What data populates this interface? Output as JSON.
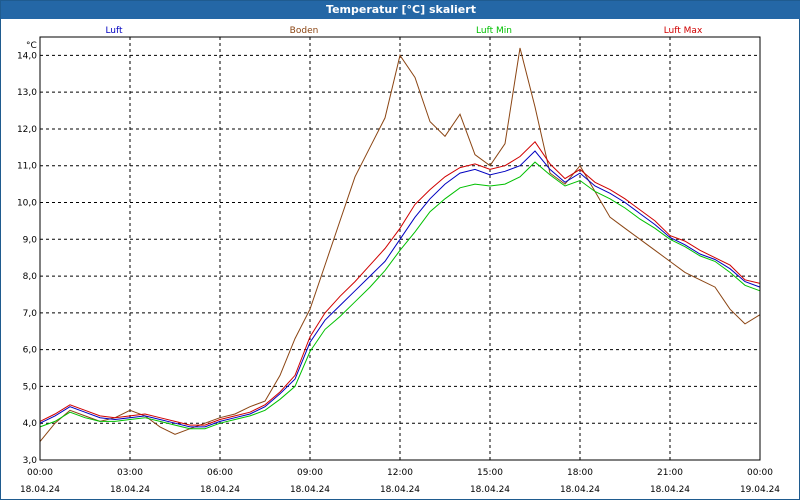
{
  "window": {
    "title": "Temperatur [°C] skaliert"
  },
  "chart_data": {
    "type": "line",
    "title": "Temperatur [°C] skaliert",
    "ylabel": "°C",
    "xlabel": "",
    "ylim": [
      3.0,
      14.5
    ],
    "xlim": [
      0,
      24
    ],
    "grid": true,
    "legend_position": "top",
    "yticks": [
      "3,0",
      "4,0",
      "5,0",
      "6,0",
      "7,0",
      "8,0",
      "9,0",
      "10,0",
      "11,0",
      "12,0",
      "13,0",
      "14,0"
    ],
    "xticks": [
      {
        "time": "00:00",
        "date": "18.04.24"
      },
      {
        "time": "03:00",
        "date": "18.04.24"
      },
      {
        "time": "06:00",
        "date": "18.04.24"
      },
      {
        "time": "09:00",
        "date": "18.04.24"
      },
      {
        "time": "12:00",
        "date": "18.04.24"
      },
      {
        "time": "15:00",
        "date": "18.04.24"
      },
      {
        "time": "18:00",
        "date": "18.04.24"
      },
      {
        "time": "21:00",
        "date": "18.04.24"
      },
      {
        "time": "00:00",
        "date": "19.04.24"
      }
    ],
    "x": [
      0,
      0.5,
      1,
      1.5,
      2,
      2.5,
      3,
      3.5,
      4,
      4.5,
      5,
      5.5,
      6,
      6.5,
      7,
      7.5,
      8,
      8.5,
      9,
      9.5,
      10,
      10.5,
      11,
      11.5,
      12,
      12.5,
      13,
      13.5,
      14,
      14.5,
      15,
      15.5,
      16,
      16.5,
      17,
      17.5,
      18,
      18.5,
      19,
      19.5,
      20,
      20.5,
      21,
      21.5,
      22,
      22.5,
      23,
      23.5,
      24
    ],
    "series": [
      {
        "name": "Luft",
        "color": "#0000c0",
        "values": [
          4.0,
          4.2,
          4.45,
          4.3,
          4.15,
          4.1,
          4.15,
          4.2,
          4.1,
          4.0,
          3.9,
          3.9,
          4.05,
          4.15,
          4.25,
          4.45,
          4.8,
          5.2,
          6.2,
          6.8,
          7.2,
          7.6,
          8.0,
          8.4,
          9.0,
          9.6,
          10.1,
          10.5,
          10.8,
          10.9,
          10.75,
          10.85,
          11.0,
          11.4,
          10.9,
          10.55,
          10.8,
          10.45,
          10.25,
          10.0,
          9.7,
          9.4,
          9.05,
          8.85,
          8.6,
          8.45,
          8.2,
          7.85,
          7.7
        ]
      },
      {
        "name": "Boden",
        "color": "#8b4513",
        "values": [
          3.5,
          4.0,
          4.35,
          4.2,
          4.05,
          4.15,
          4.35,
          4.2,
          3.9,
          3.7,
          3.85,
          4.0,
          4.15,
          4.25,
          4.45,
          4.6,
          5.3,
          6.3,
          7.1,
          8.3,
          9.5,
          10.7,
          11.5,
          12.3,
          14.0,
          13.4,
          12.2,
          11.8,
          12.4,
          11.3,
          11.0,
          11.6,
          14.2,
          12.6,
          10.8,
          10.5,
          11.0,
          10.3,
          9.6,
          9.3,
          9.0,
          8.7,
          8.4,
          8.1,
          7.9,
          7.7,
          7.1,
          6.7,
          6.95
        ]
      },
      {
        "name": "Luft Min",
        "color": "#00c000",
        "values": [
          3.9,
          4.05,
          4.3,
          4.15,
          4.05,
          4.05,
          4.1,
          4.15,
          4.05,
          3.95,
          3.85,
          3.85,
          4.0,
          4.1,
          4.2,
          4.35,
          4.65,
          5.0,
          5.95,
          6.55,
          6.9,
          7.3,
          7.7,
          8.15,
          8.7,
          9.2,
          9.75,
          10.1,
          10.4,
          10.5,
          10.45,
          10.5,
          10.7,
          11.1,
          10.75,
          10.45,
          10.6,
          10.3,
          10.1,
          9.85,
          9.55,
          9.3,
          9.0,
          8.8,
          8.55,
          8.4,
          8.1,
          7.75,
          7.6
        ]
      },
      {
        "name": "Luft Max",
        "color": "#d00000",
        "values": [
          4.05,
          4.25,
          4.5,
          4.35,
          4.2,
          4.15,
          4.2,
          4.25,
          4.15,
          4.05,
          3.95,
          3.95,
          4.1,
          4.2,
          4.3,
          4.5,
          4.85,
          5.3,
          6.35,
          7.0,
          7.45,
          7.85,
          8.3,
          8.75,
          9.3,
          9.95,
          10.35,
          10.7,
          10.95,
          11.05,
          10.9,
          11.0,
          11.25,
          11.65,
          11.05,
          10.65,
          10.9,
          10.55,
          10.35,
          10.1,
          9.8,
          9.5,
          9.1,
          8.95,
          8.7,
          8.5,
          8.3,
          7.9,
          7.8
        ]
      }
    ]
  }
}
